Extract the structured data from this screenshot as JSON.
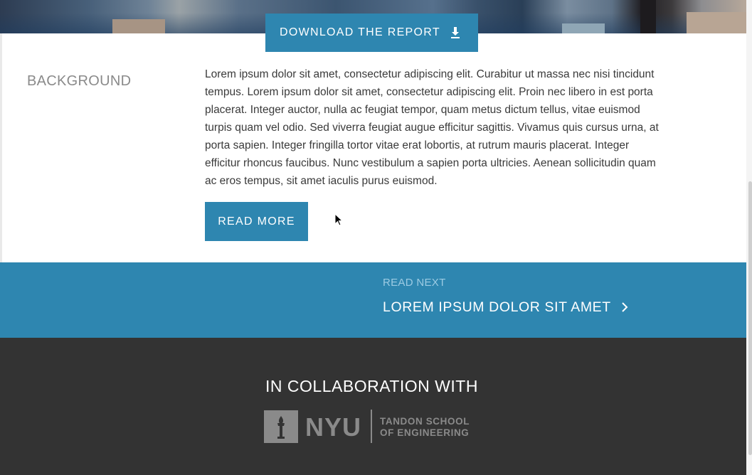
{
  "hero": {
    "download_label": "DOWNLOAD THE REPORT",
    "download_icon": "download-icon"
  },
  "background": {
    "title": "BACKGROUND",
    "body": "Lorem ipsum dolor sit amet, consectetur adipiscing elit. Curabitur ut massa nec nisi tincidunt tempus. Lorem ipsum dolor sit amet, consectetur adipiscing elit. Proin nec libero in est porta placerat. Integer auctor, nulla ac feugiat tempor, quam metus dictum tellus, vitae euismod turpis quam vel odio. Sed viverra feugiat augue efficitur sagittis. Vivamus quis cursus urna, at porta sapien. Integer fringilla tortor vitae erat lobortis, at rutrum mauris placerat. Integer efficitur rhoncus faucibus. Nunc vestibulum a sapien porta ultricies. Aenean sollicitudin quam ac eros tempus, sit amet iaculis purus euismod.",
    "read_more_label": "READ MORE"
  },
  "read_next": {
    "label": "READ NEXT",
    "title": "LOREM IPSUM DOLOR SIT AMET",
    "icon": "chevron-right-icon"
  },
  "footer": {
    "collab_label": "IN COLLABORATION WITH",
    "logo": {
      "name": "NYU",
      "line1": "TANDON SCHOOL",
      "line2": "OF ENGINEERING"
    }
  },
  "colors": {
    "accent": "#2e86b0",
    "footer_bg": "#333333",
    "muted_text": "#8a8a8a"
  }
}
